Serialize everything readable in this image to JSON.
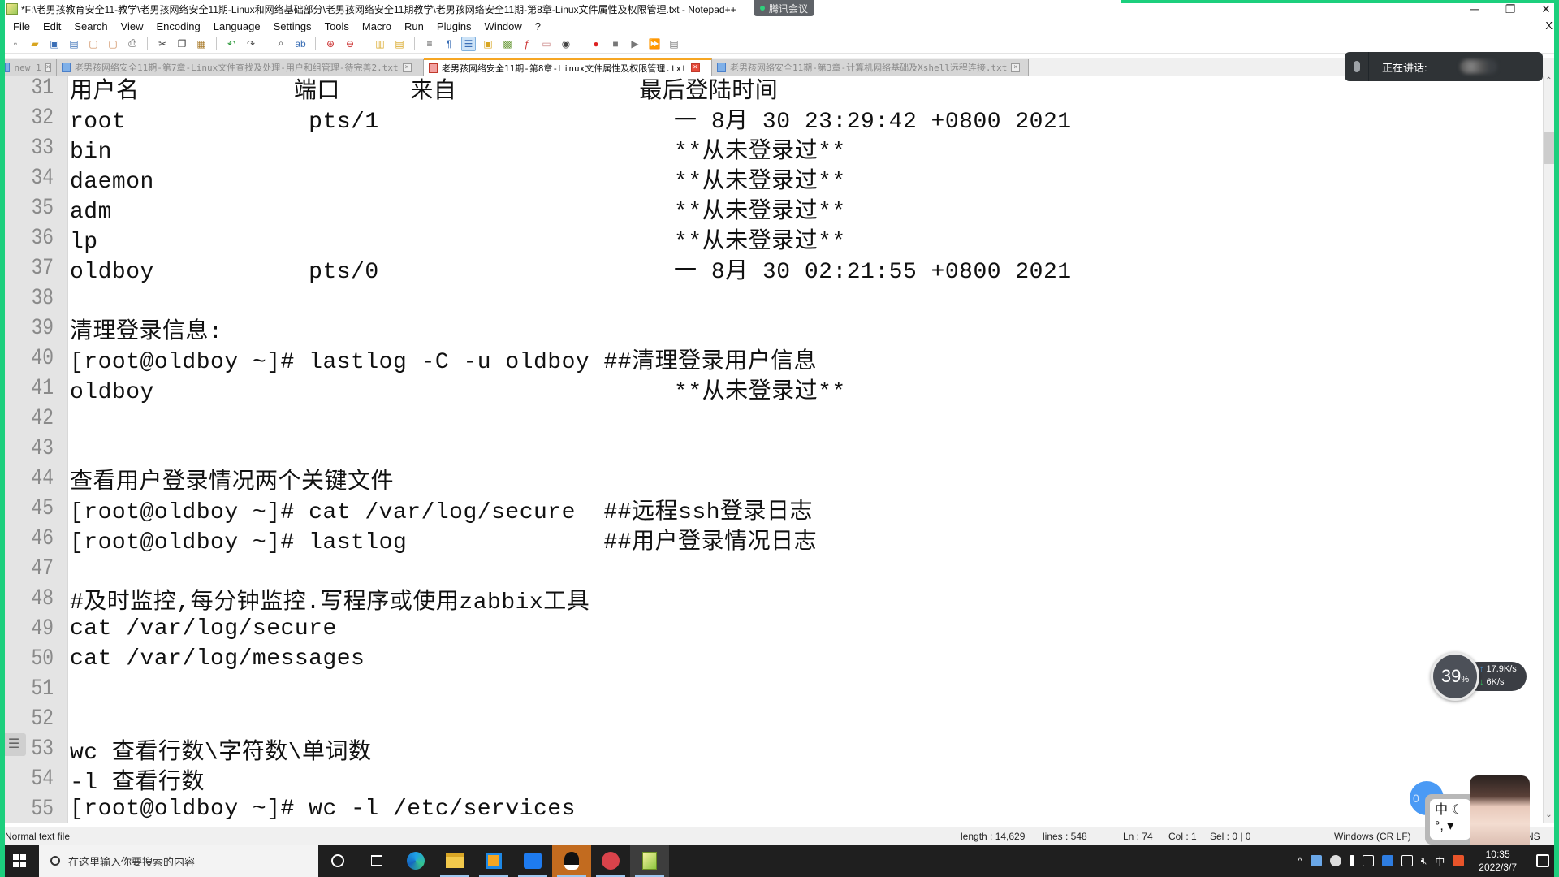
{
  "window": {
    "title": "*F:\\老男孩教育安全11-教学\\老男孩网络安全11期-Linux和网络基础部分\\老男孩网络安全11期教学\\老男孩网络安全11期-第8章-Linux文件属性及权限管理.txt - Notepad++",
    "meeting_badge": "腾讯会议",
    "controls": {
      "minimize": "─",
      "restore": "❐",
      "close": "✕"
    },
    "doc_close": "X"
  },
  "menu": [
    "File",
    "Edit",
    "Search",
    "View",
    "Encoding",
    "Language",
    "Settings",
    "Tools",
    "Macro",
    "Run",
    "Plugins",
    "Window",
    "?"
  ],
  "toolbar": {
    "buttons": [
      "new-file",
      "open-file",
      "save",
      "save-all",
      "close",
      "close-all",
      "print",
      "cut",
      "copy",
      "paste",
      "undo",
      "redo",
      "find",
      "replace",
      "zoom-in",
      "zoom-out",
      "sync-vertical",
      "sync-horizontal",
      "word-wrap",
      "show-all-chars",
      "indent-guide",
      "user-define-lang",
      "doc-map",
      "function-list",
      "folder-as-workspace",
      "monitoring",
      "record-macro",
      "stop-record",
      "play-macro",
      "run-macro-multiple",
      "save-macro"
    ]
  },
  "tabs": [
    {
      "label": "new 1",
      "active": false
    },
    {
      "label": "老男孩网络安全11期-第7章-Linux文件查找及处理-用户和组管理-待完善2.txt",
      "active": false
    },
    {
      "label": "老男孩网络安全11期-第8章-Linux文件属性及权限管理.txt",
      "active": true
    },
    {
      "label": "老男孩网络安全11期-第3章-计算机网络基础及Xshell远程连接.txt",
      "active": false
    }
  ],
  "speaking": {
    "label": "正在讲话:"
  },
  "editor": {
    "lines": [
      {
        "n": "31",
        "text": "用户名           端口     来自             最后登陆时间"
      },
      {
        "n": "32",
        "text": "root             pts/1                     一 8月 30 23:29:42 +0800 2021"
      },
      {
        "n": "33",
        "text": "bin                                        **从未登录过**"
      },
      {
        "n": "34",
        "text": "daemon                                     **从未登录过**"
      },
      {
        "n": "35",
        "text": "adm                                        **从未登录过**"
      },
      {
        "n": "36",
        "text": "lp                                         **从未登录过**"
      },
      {
        "n": "37",
        "text": "oldboy           pts/0                     一 8月 30 02:21:55 +0800 2021"
      },
      {
        "n": "38",
        "text": ""
      },
      {
        "n": "39",
        "text": "清理登录信息:"
      },
      {
        "n": "40",
        "text": "[root@oldboy ~]# lastlog -C -u oldboy ##清理登录用户信息"
      },
      {
        "n": "41",
        "text": "oldboy                                     **从未登录过**"
      },
      {
        "n": "42",
        "text": ""
      },
      {
        "n": "43",
        "text": ""
      },
      {
        "n": "44",
        "text": "查看用户登录情况两个关键文件"
      },
      {
        "n": "45",
        "text": "[root@oldboy ~]# cat /var/log/secure  ##远程ssh登录日志"
      },
      {
        "n": "46",
        "text": "[root@oldboy ~]# lastlog              ##用户登录情况日志"
      },
      {
        "n": "47",
        "text": ""
      },
      {
        "n": "48",
        "text": "#及时监控,每分钟监控.写程序或使用zabbix工具"
      },
      {
        "n": "49",
        "text": "cat /var/log/secure"
      },
      {
        "n": "50",
        "text": "cat /var/log/messages"
      },
      {
        "n": "51",
        "text": ""
      },
      {
        "n": "52",
        "text": ""
      },
      {
        "n": "53",
        "text": "wc 查看行数\\字符数\\单词数"
      },
      {
        "n": "54",
        "text": "-l 查看行数"
      },
      {
        "n": "55",
        "text": "[root@oldboy ~]# wc -l /etc/services"
      }
    ]
  },
  "status": {
    "file_type": "Normal text file",
    "length": "length : 14,629",
    "lines": "lines : 548",
    "ln": "Ln : 74",
    "col": "Col : 1",
    "sel": "Sel : 0 | 0",
    "eol": "Windows (CR LF)",
    "encoding_partial": "NS"
  },
  "net_widget": {
    "percent": "39",
    "percent_sign": "%",
    "upload": "17.9K/s",
    "download": "6K/s"
  },
  "ime": {
    "lang": "中",
    "badge": "0"
  },
  "taskbar": {
    "search_placeholder": "在这里输入你要搜索的内容",
    "apps": [
      "cortana",
      "task-view",
      "edge",
      "file-explorer",
      "app-3",
      "app-4",
      "qq",
      "app-6",
      "notepad-plus-plus"
    ],
    "tray_input": "中",
    "time": "10:35",
    "date": "2022/3/7"
  }
}
